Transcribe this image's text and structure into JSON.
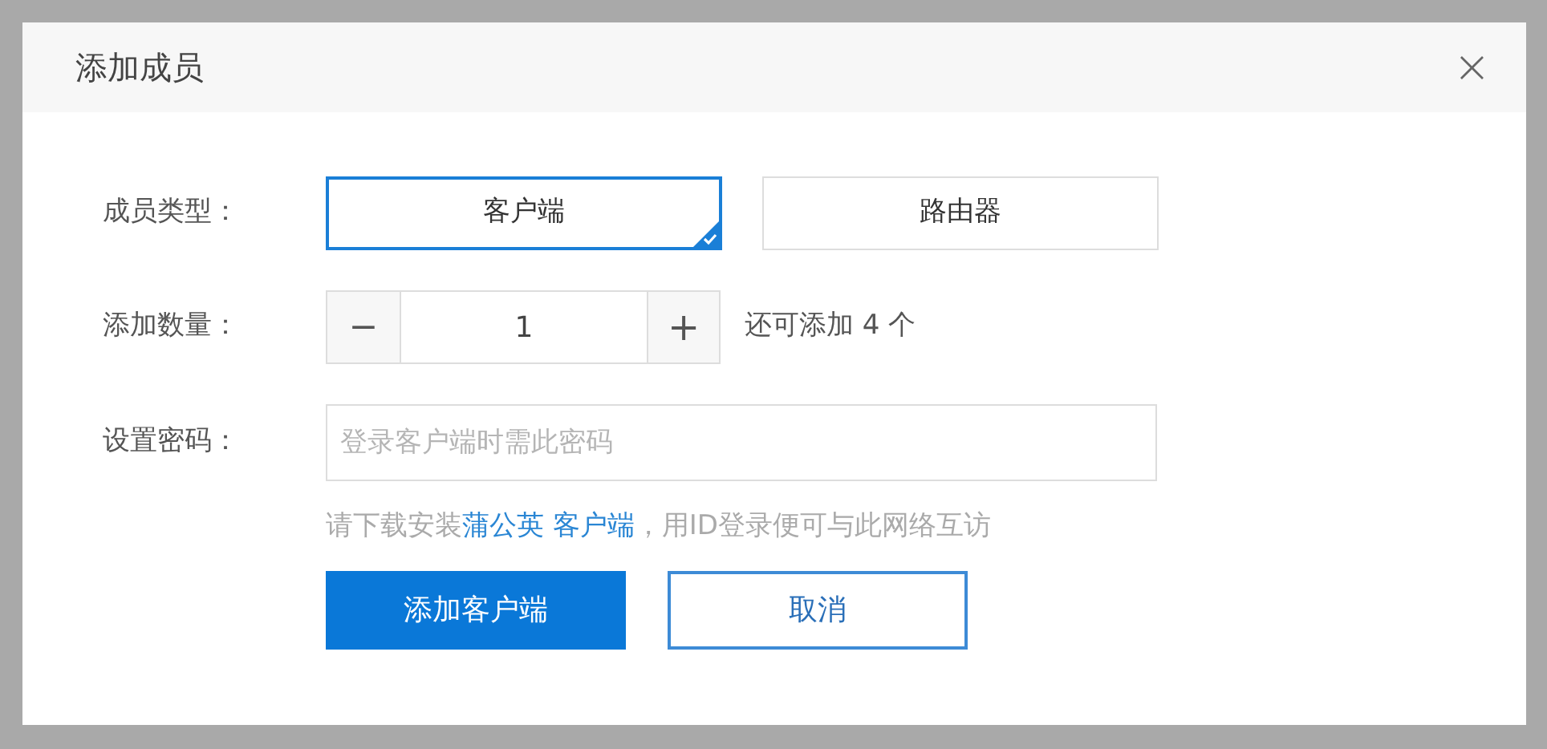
{
  "dialog": {
    "title": "添加成员",
    "close": "×"
  },
  "member_type": {
    "label": "成员类型：",
    "options": [
      {
        "label": "客户端",
        "selected": true
      },
      {
        "label": "路由器",
        "selected": false
      }
    ]
  },
  "quantity": {
    "label": "添加数量：",
    "decrement": "−",
    "value": "1",
    "increment": "+",
    "remaining": "还可添加 4 个"
  },
  "password": {
    "label": "设置密码：",
    "placeholder": "登录客户端时需此密码"
  },
  "hint": {
    "before": "请下载安装",
    "link": "蒲公英 客户端",
    "after": "，用ID登录便可与此网络互访"
  },
  "buttons": [
    {
      "kind": "primary",
      "label": "添加客户端"
    },
    {
      "kind": "secondary",
      "label": "取消"
    }
  ]
}
